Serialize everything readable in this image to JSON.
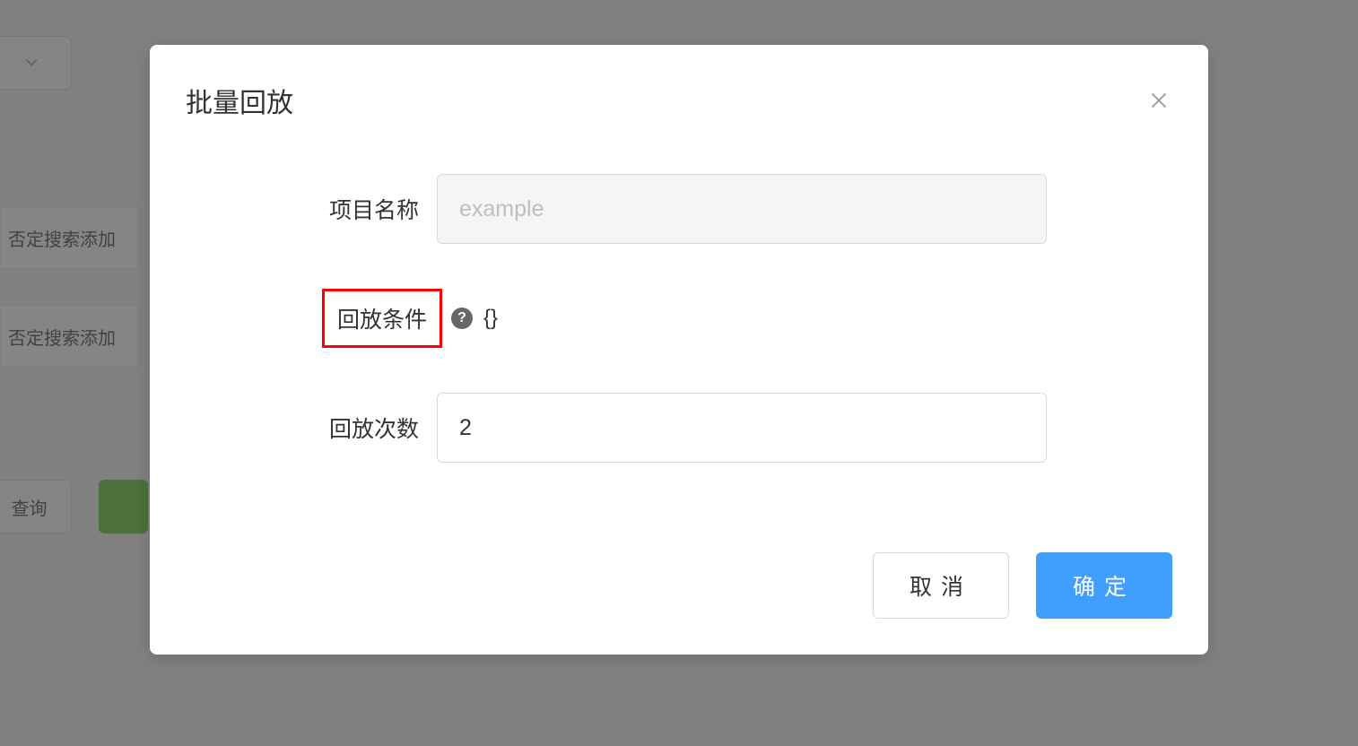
{
  "background": {
    "row1_label": "否定搜索添加",
    "row2_label": "否定搜索添加",
    "query_button": "查询"
  },
  "modal": {
    "title": "批量回放",
    "form": {
      "project_name": {
        "label": "项目名称",
        "value": "example"
      },
      "replay_condition": {
        "label": "回放条件",
        "value": "{}"
      },
      "replay_count": {
        "label": "回放次数",
        "value": "2"
      }
    },
    "footer": {
      "cancel": "取消",
      "confirm": "确定"
    }
  }
}
